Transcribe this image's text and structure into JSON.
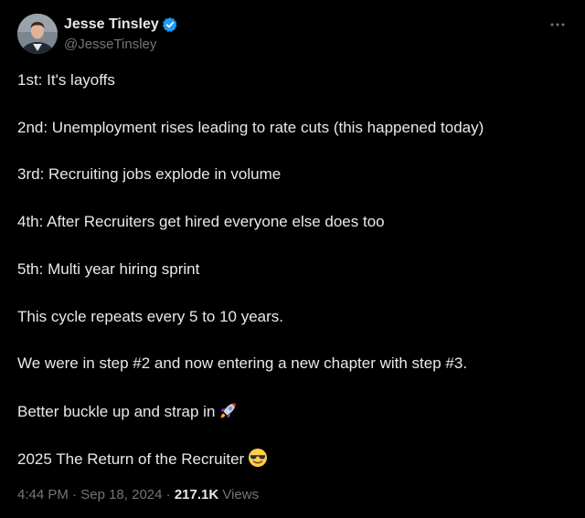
{
  "author": {
    "name": "Jesse Tinsley",
    "handle": "@JesseTinsley",
    "verified": true
  },
  "tweet": {
    "lines": [
      "1st: It's layoffs",
      "2nd: Unemployment rises leading to rate cuts (this happened today)",
      "3rd: Recruiting jobs explode in volume",
      "4th: After Recruiters get hired everyone else does too",
      "5th: Multi year hiring sprint",
      "This cycle repeats every 5 to 10 years.",
      "We were in step #2 and now entering a new chapter with step #3.",
      "Better buckle up and strap in",
      "2025 The Return of the Recruiter"
    ],
    "emojis": {
      "line8": "rocket-emoji",
      "line9": "sunglasses-emoji"
    }
  },
  "meta": {
    "time": "4:44 PM",
    "separator": "·",
    "date": "Sep 18, 2024",
    "views_count": "217.1K",
    "views_label": "Views"
  },
  "icons": {
    "verified": "verified-badge-icon",
    "more": "more-options-icon"
  },
  "colors": {
    "background": "#000000",
    "text": "#e7e9ea",
    "muted": "#71767b",
    "verified_blue": "#1d9bf0"
  }
}
